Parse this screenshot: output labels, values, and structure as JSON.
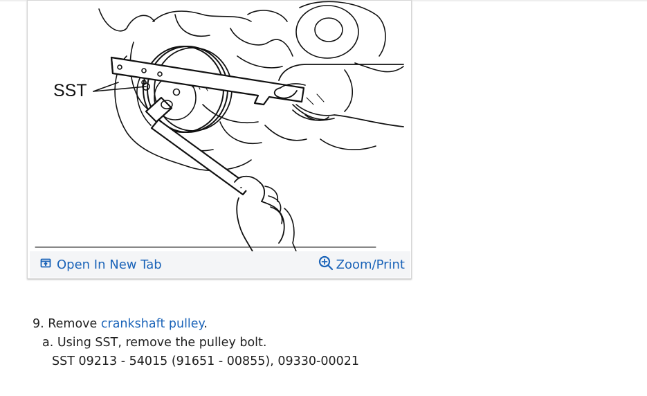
{
  "figure": {
    "callout_label": "SST",
    "toolbar": {
      "open_new_tab_label": "Open In New Tab",
      "zoom_print_label": "Zoom/Print",
      "open_new_tab_icon": "open-in-new-tab-icon",
      "zoom_icon": "zoom-in-magnifier-icon"
    }
  },
  "instructions": {
    "step_number": "9.",
    "step_prefix": "Remove",
    "step_link": "crankshaft pulley",
    "step_suffix": ".",
    "substep_letter": "a.",
    "substep_text": "Using SST, remove the pulley bolt.",
    "sst_spec": "SST 09213 - 54015 (91651 - 00855), 09330-00021"
  },
  "colors": {
    "link": "#1a63b8",
    "toolbar_bg": "#f4f5f7",
    "text": "#212121"
  }
}
